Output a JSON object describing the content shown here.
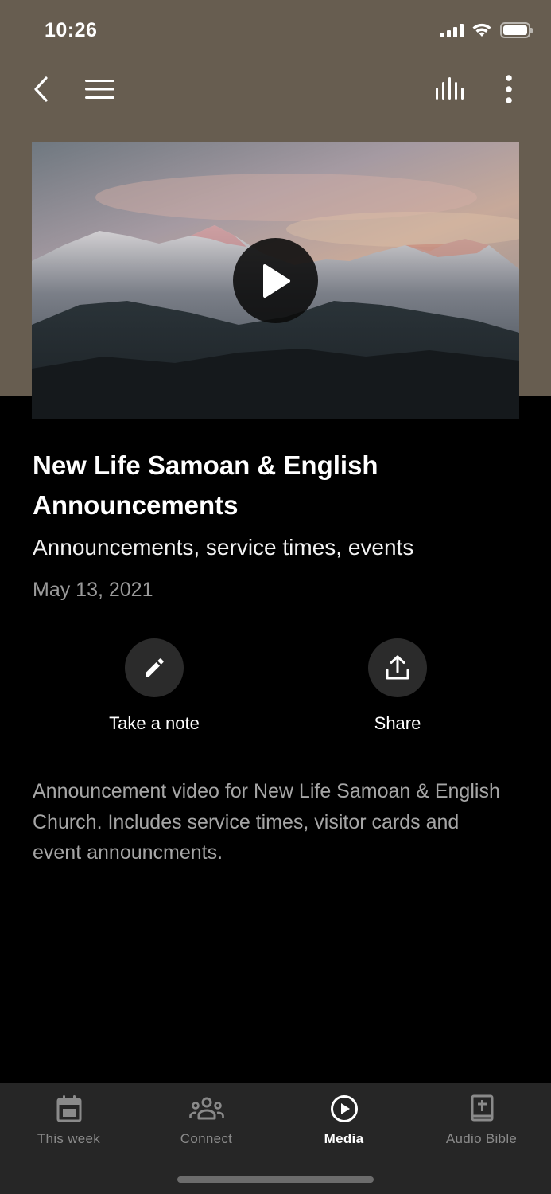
{
  "status_bar": {
    "time": "10:26"
  },
  "media": {
    "title": "New Life Samoan & English Announcements",
    "subtitle": "Announcements, service times, events",
    "date": "May 13, 2021",
    "description": "Announcement video for New Life Samoan & English Church. Includes service times, visitor cards and event announcments."
  },
  "actions": {
    "note_label": "Take a note",
    "share_label": "Share"
  },
  "tabs": [
    {
      "label": "This week",
      "icon": "calendar-icon"
    },
    {
      "label": "Connect",
      "icon": "groups-icon"
    },
    {
      "label": "Media",
      "icon": "play-circle-icon"
    },
    {
      "label": "Audio Bible",
      "icon": "bible-icon"
    }
  ],
  "colors": {
    "header_bg": "#675d50",
    "page_bg": "#000000",
    "tab_bar_bg": "#262626",
    "active_tab": "#ffffff",
    "inactive_tab": "#8a8a8a"
  }
}
